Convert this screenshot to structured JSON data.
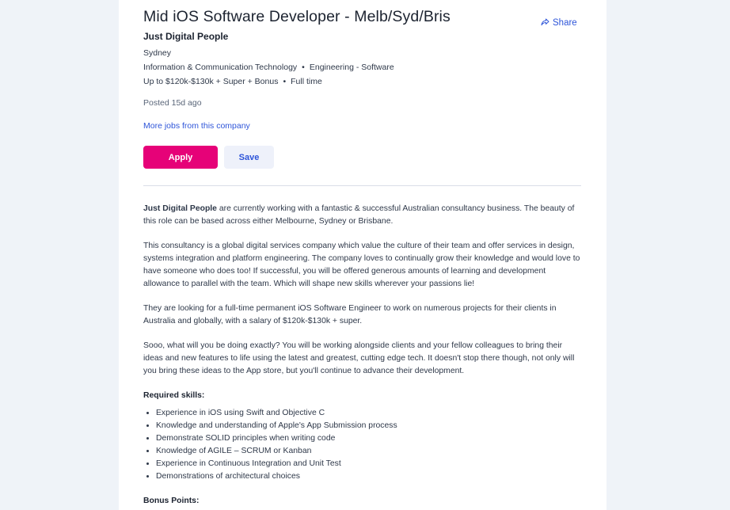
{
  "job": {
    "title": "Mid iOS Software Developer - Melb/Syd/Bris",
    "company": "Just Digital People",
    "location": "Sydney",
    "classification": "Information & Communication Technology",
    "subclassification": "Engineering - Software",
    "salary": "Up to $120k-$130k + Super + Bonus",
    "work_type": "Full time",
    "separator": "•",
    "posted": "Posted 15d ago",
    "more_jobs_link": "More jobs from this company"
  },
  "actions": {
    "share_label": "Share",
    "apply_label": "Apply",
    "save_label": "Save"
  },
  "description": {
    "p1_bold": "Just Digital People",
    "p1_rest": " are currently working with a fantastic & successful Australian consultancy business. The beauty of this role can be based across either Melbourne, Sydney or Brisbane.",
    "p2": "This consultancy is a global digital services company which value the culture of their team and offer services in design, systems integration and platform engineering. The company loves to continually grow their knowledge and would love to have someone who does too! If successful, you will be offered generous amounts of learning and development allowance to parallel with the team. Which will shape new skills wherever your passions lie!",
    "p3": "They are looking for a full-time permanent iOS Software Engineer to work on numerous projects for their clients in Australia and globally, with a salary of $120k-$130k + super.",
    "p4": "Sooo, what will you be doing exactly? You will be working alongside clients and your fellow colleagues to bring their ideas and new features to life using the latest and greatest, cutting edge tech. It doesn't stop there though, not only will you bring these ideas to the App store, but you'll continue to advance their development.",
    "required_heading": "Required skills:",
    "required_skills": [
      "Experience in iOS using Swift and Objective C",
      "Knowledge and understanding of Apple's App Submission process",
      "Demonstrate SOLID principles when writing code",
      "Knowledge of AGILE – SCRUM or Kanban",
      "Experience in Continuous Integration and Unit Test",
      "Demonstrations of architectural choices"
    ],
    "bonus_heading": "Bonus Points:"
  },
  "colors": {
    "apply_bg": "#e60278",
    "link": "#2e55d9",
    "save_bg": "#eef1fa",
    "page_bg": "#eff3f8"
  }
}
